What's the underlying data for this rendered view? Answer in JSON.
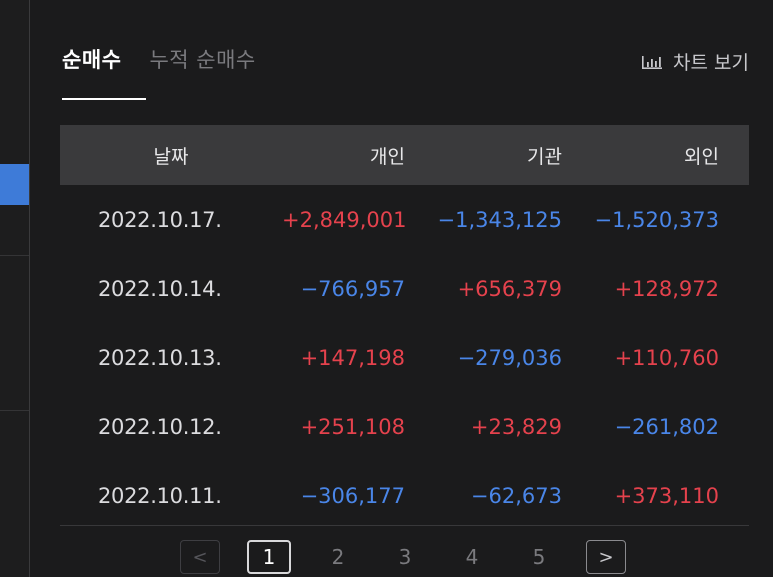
{
  "tabs": [
    {
      "label": "순매수",
      "active": true
    },
    {
      "label": "누적 순매수",
      "active": false
    }
  ],
  "chart_link": {
    "label": "차트 보기",
    "icon": "bar-chart-icon"
  },
  "table": {
    "headers": [
      "날짜",
      "개인",
      "기관",
      "외인"
    ],
    "rows": [
      {
        "date": "2022.10.17.",
        "individual": "+2,849,001",
        "institution": "−1,343,125",
        "foreign": "−1,520,373"
      },
      {
        "date": "2022.10.14.",
        "individual": "−766,957",
        "institution": "+656,379",
        "foreign": "+128,972"
      },
      {
        "date": "2022.10.13.",
        "individual": "+147,198",
        "institution": "−279,036",
        "foreign": "+110,760"
      },
      {
        "date": "2022.10.12.",
        "individual": "+251,108",
        "institution": "+23,829",
        "foreign": "−261,802"
      },
      {
        "date": "2022.10.11.",
        "individual": "−306,177",
        "institution": "−62,673",
        "foreign": "+373,110"
      }
    ]
  },
  "pagination": {
    "prev_label": "<",
    "next_label": ">",
    "pages": [
      "1",
      "2",
      "3",
      "4",
      "5"
    ],
    "current": "1"
  },
  "colors": {
    "positive": "#e5424d",
    "negative": "#4a86e8",
    "accent": "#3e7bd8",
    "background": "#1b1b1c",
    "header_bg": "#3a3a3c"
  }
}
